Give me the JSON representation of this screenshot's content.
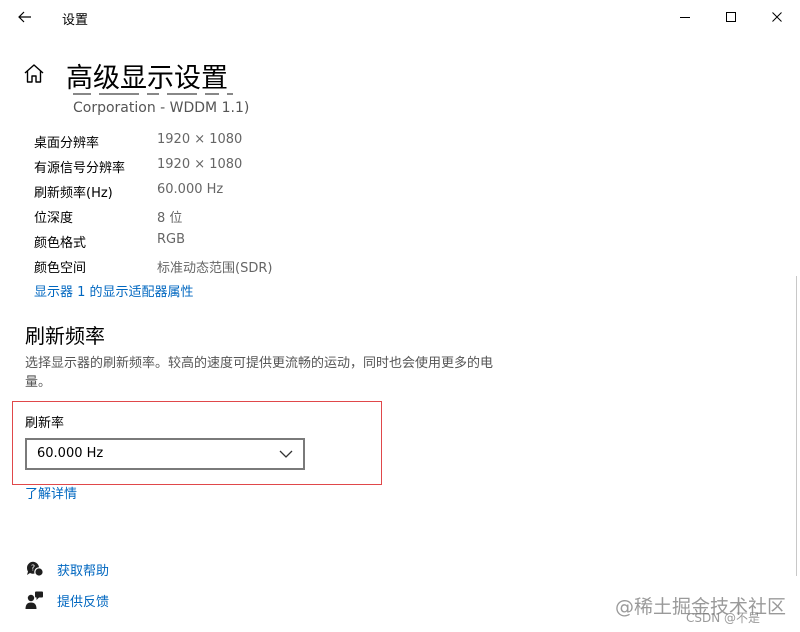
{
  "titlebar": {
    "app_title": "设置",
    "icons": {
      "back": "back-arrow-icon",
      "minimize": "minimize-icon",
      "maximize": "maximize-icon",
      "close": "close-icon"
    }
  },
  "page": {
    "title": "高级显示设置",
    "adapter_continuation": "Corporation - WDDM 1.1)"
  },
  "display_info": [
    {
      "label": "桌面分辨率",
      "value": "1920 × 1080"
    },
    {
      "label": "有源信号分辨率",
      "value": "1920 × 1080"
    },
    {
      "label": "刷新频率(Hz)",
      "value": "60.000 Hz"
    },
    {
      "label": "位深度",
      "value": "8 位"
    },
    {
      "label": "颜色格式",
      "value": "RGB"
    },
    {
      "label": "颜色空间",
      "value": "标准动态范围(SDR)"
    }
  ],
  "adapter_properties_link": "显示器 1 的显示适配器属性",
  "refresh_section": {
    "title": "刷新频率",
    "description": "选择显示器的刷新频率。较高的速度可提供更流畅的运动，同时也会使用更多的电量。",
    "rate_label": "刷新率",
    "selected_rate": "60.000 Hz",
    "learn_more": "了解详情"
  },
  "help": {
    "get_help": "获取帮助",
    "feedback": "提供反馈"
  },
  "watermark": {
    "main": "@稀土掘金技术社区",
    "sub": "CSDN @不是"
  },
  "colors": {
    "accent": "#0067c0",
    "highlight_box": "#e0484a"
  }
}
